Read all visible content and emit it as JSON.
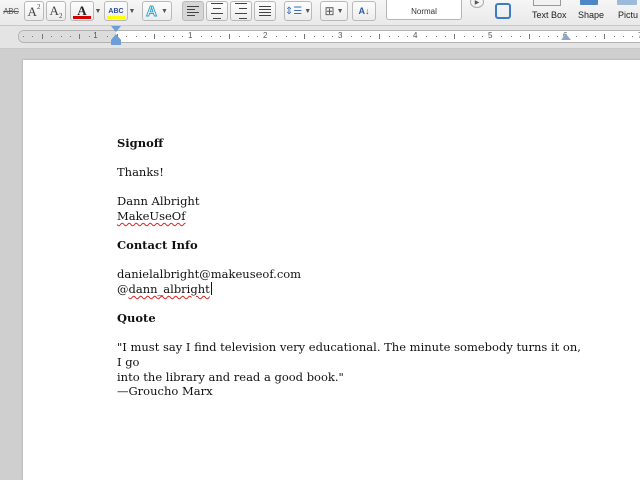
{
  "ribbon": {
    "strikethrough_label": "ABC",
    "superscript_label": "A",
    "superscript_mark": "2",
    "subscript_label": "A",
    "subscript_mark": "2",
    "font_color_label": "A",
    "font_color": "#d40000",
    "highlight_label": "ABC",
    "highlight_color": "#ffff00",
    "text_effects_label": "A",
    "style_name": "Normal",
    "text_box_label": "Text Box",
    "shape_label": "Shape",
    "picture_label": "Pictu"
  },
  "ruler": {
    "numbers": [
      "1",
      "1",
      "2",
      "3",
      "4",
      "5",
      "6",
      "7"
    ]
  },
  "document": {
    "signoff_heading": "Signoff",
    "thanks": "Thanks!",
    "name": "Dann Albright",
    "company": "MakeUseOf",
    "contact_heading": "Contact Info",
    "email": "danielalbright@makeuseof.com",
    "handle_prefix": "@",
    "handle": "dann_albright",
    "quote_heading": "Quote",
    "quote_line1": "\"I must say I find television very educational. The minute somebody turns it on, I go",
    "quote_line2": "into the library and read a good book.\"",
    "attribution": "—Groucho Marx"
  }
}
